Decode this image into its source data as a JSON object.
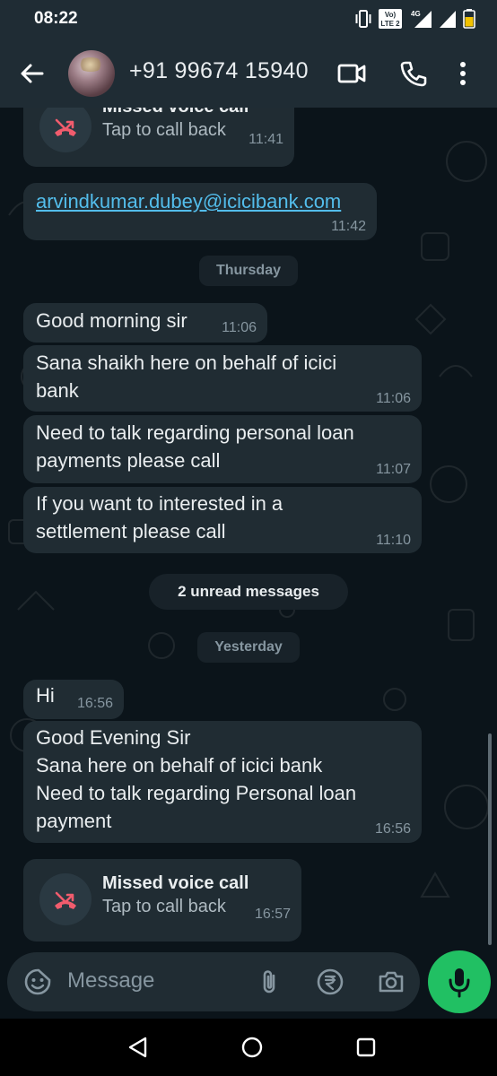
{
  "status_bar": {
    "time": "08:22",
    "volte_label_top": "Vo)",
    "volte_label_bottom": "LTE 2",
    "network_label": "4G",
    "icons": [
      "vibrate-icon",
      "volte-icon",
      "signal-icon",
      "signal-icon",
      "battery-icon"
    ]
  },
  "header": {
    "contact": "+91 99674 15940",
    "icons": [
      "back-arrow-icon",
      "video-call-icon",
      "voice-call-icon",
      "more-icon"
    ]
  },
  "messages": {
    "call1": {
      "title": "Missed voice call",
      "sub": "Tap to call back",
      "time": "11:41"
    },
    "email": {
      "text": "arvindkumar.dubey@icicibank.com",
      "time": "11:42"
    },
    "date1": "Thursday",
    "m1": {
      "text": "Good morning sir",
      "time": "11:06"
    },
    "m2": {
      "line1": "Sana shaikh here on behalf of icici",
      "line2": "bank",
      "time": "11:06"
    },
    "m3": {
      "line1": "Need to talk regarding personal loan",
      "line2": "payments please call",
      "time": "11:07"
    },
    "m4": {
      "line1": "If you want to interested in a",
      "line2": "settlement please call",
      "time": "11:10"
    },
    "unread": "2 unread messages",
    "date2": "Yesterday",
    "m5": {
      "text": "Hi",
      "time": "16:56"
    },
    "m6": {
      "line1": "Good Evening Sir",
      "line2": "Sana here on behalf of icici bank",
      "line3": "Need to talk regarding Personal loan",
      "line4": "payment",
      "time": "16:56"
    },
    "call2": {
      "title": "Missed voice call",
      "sub": "Tap to call back",
      "time": "16:57"
    }
  },
  "composer": {
    "placeholder": "Message",
    "icons": [
      "emoji-icon",
      "attach-icon",
      "rupee-payment-icon",
      "camera-icon",
      "mic-icon"
    ]
  },
  "colors": {
    "background": "#0b141a",
    "bar": "#1f2c34",
    "bubble": "#202c33",
    "accent_green": "#21c063",
    "link": "#53bdeb",
    "missed_call_red": "#f15c6d",
    "meta_text": "#8696a0"
  },
  "nav_bar": {
    "icons": [
      "back-triangle-icon",
      "home-circle-icon",
      "recents-square-icon"
    ]
  }
}
